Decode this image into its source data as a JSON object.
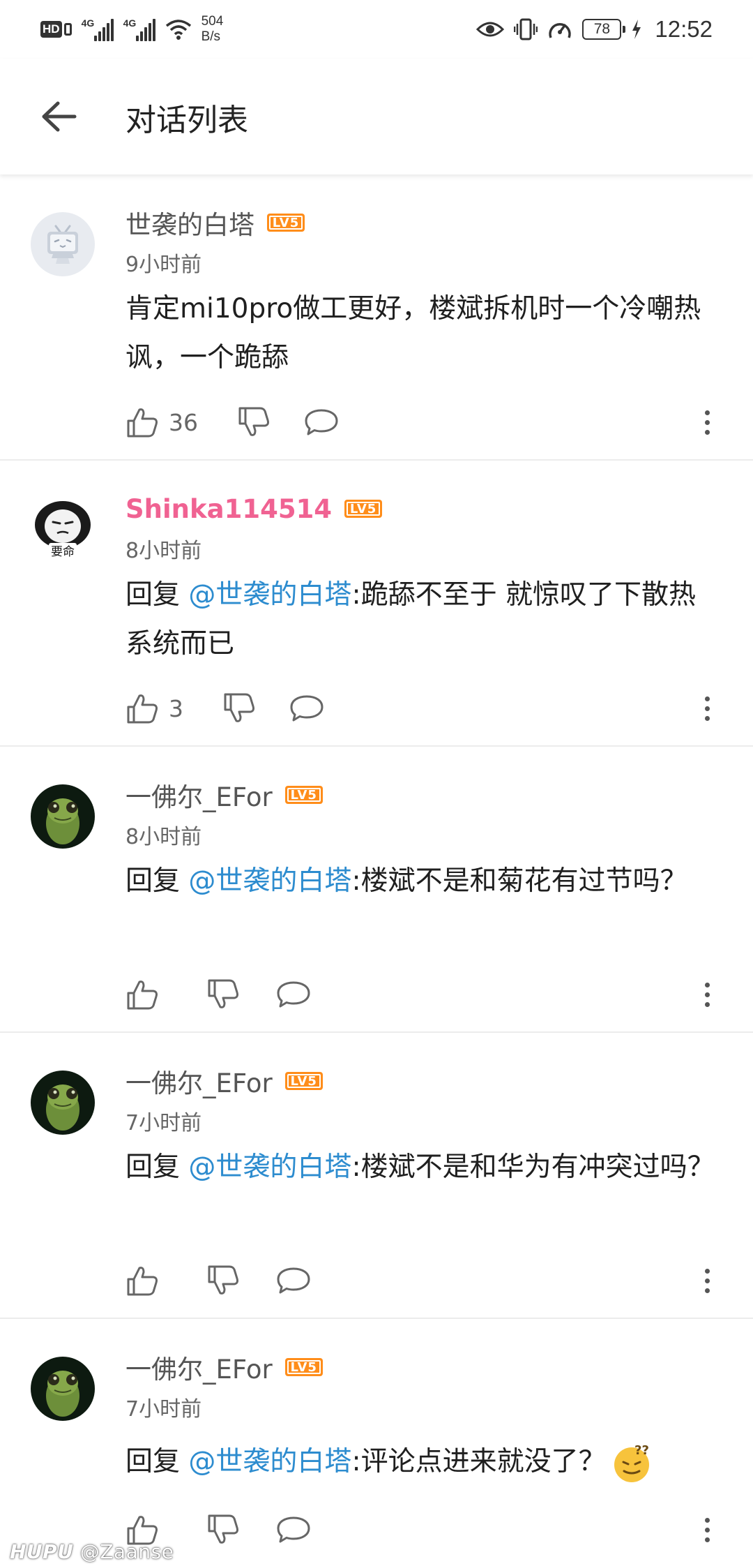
{
  "status_bar": {
    "hd_label": "HD",
    "sim1_label": "4G",
    "sim2_label": "4G",
    "net_speed_value": "504",
    "net_speed_unit": "B/s",
    "battery": "78",
    "time": "12:52"
  },
  "header": {
    "title": "对话列表"
  },
  "comments": [
    {
      "username": "世袭的白塔",
      "level": "LV5",
      "time": "9小时前",
      "reply_prefix": "",
      "mention": "",
      "text": "肯定mi10pro做工更好，楼斌拆机时一个冷嘲热讽，一个跪舔",
      "likes": "36"
    },
    {
      "username": "Shinka114514",
      "level": "LV5",
      "time": "8小时前",
      "reply_prefix": "回复",
      "mention": "@世袭的白塔",
      "text": ":跪舔不至于 就惊叹了下散热系统而已",
      "likes": "3"
    },
    {
      "username": "一佛尔_EFor",
      "level": "LV5",
      "time": "8小时前",
      "reply_prefix": "回复",
      "mention": "@世袭的白塔",
      "text": ":楼斌不是和菊花有过节吗？",
      "likes": ""
    },
    {
      "username": "一佛尔_EFor",
      "level": "LV5",
      "time": "7小时前",
      "reply_prefix": "回复",
      "mention": "@世袭的白塔",
      "text": ":楼斌不是和华为有冲突过吗？",
      "likes": ""
    },
    {
      "username": "一佛尔_EFor",
      "level": "LV5",
      "time": "7小时前",
      "reply_prefix": "回复",
      "mention": "@世袭的白塔",
      "text": ":评论点进来就没了？",
      "likes": ""
    }
  ],
  "watermark": {
    "brand": "HUPU",
    "handle": "@Zaanse"
  },
  "colors": {
    "mention": "#2d8ccf",
    "level_badge": "#ff8d1a",
    "pink_username": "#f06292"
  },
  "icons": [
    "back-arrow-icon",
    "thumb-up-icon",
    "thumb-down-icon",
    "comment-bubble-icon",
    "more-vertical-icon",
    "eye-icon",
    "vibrate-icon",
    "wifi-icon",
    "signal-icon",
    "battery-icon",
    "charging-icon"
  ]
}
